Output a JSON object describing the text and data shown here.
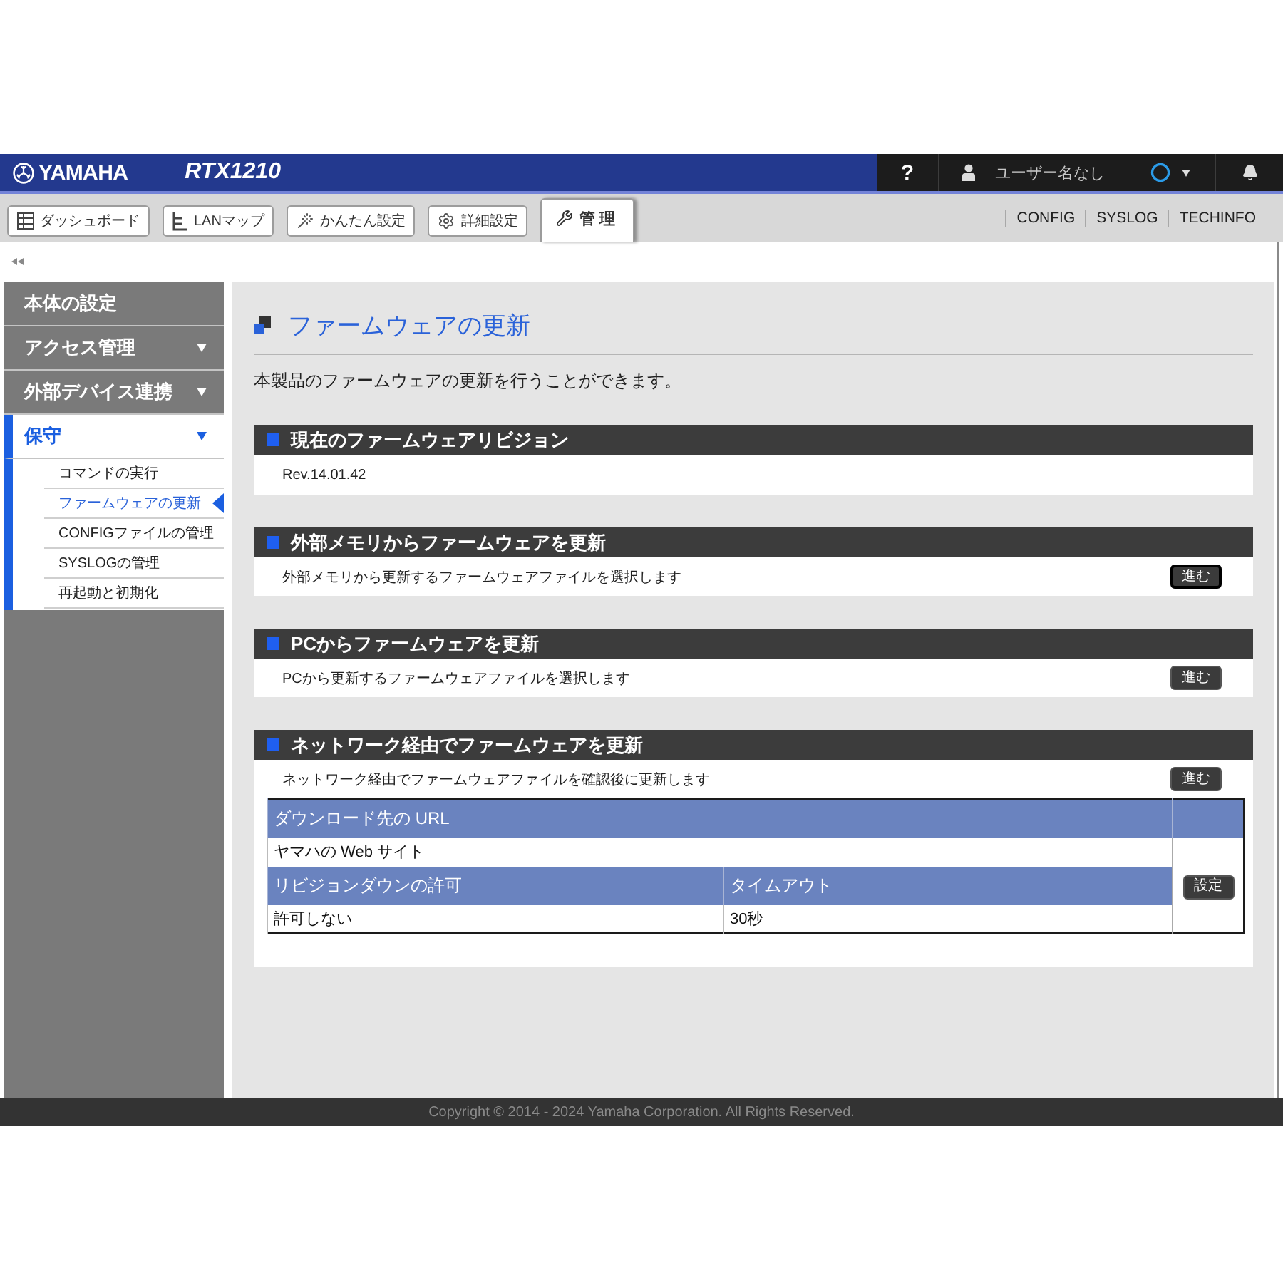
{
  "header": {
    "brand": "YAMAHA",
    "model": "RTX1210",
    "help": "?",
    "user_name": "ユーザー名なし"
  },
  "tabs": [
    {
      "label": "ダッシュボード",
      "selected": false
    },
    {
      "label": "LANマップ",
      "selected": false
    },
    {
      "label": "かんたん設定",
      "selected": false
    },
    {
      "label": "詳細設定",
      "selected": false
    },
    {
      "label": "管 理",
      "selected": true
    }
  ],
  "quick_links": [
    "CONFIG",
    "SYSLOG",
    "TECHINFO"
  ],
  "sidebar": {
    "items": [
      {
        "label": "本体の設定",
        "kind": "link",
        "selected": false
      },
      {
        "label": "アクセス管理",
        "kind": "group",
        "expanded": false
      },
      {
        "label": "外部デバイス連携",
        "kind": "group",
        "expanded": false
      },
      {
        "label": "保守",
        "kind": "group",
        "expanded": true,
        "children": [
          {
            "label": "コマンドの実行",
            "selected": false
          },
          {
            "label": "ファームウェアの更新",
            "selected": true
          },
          {
            "label": "CONFIGファイルの管理",
            "selected": false
          },
          {
            "label": "SYSLOGの管理",
            "selected": false
          },
          {
            "label": "再起動と初期化",
            "selected": false
          }
        ]
      }
    ]
  },
  "page": {
    "title": "ファームウェアの更新",
    "description": "本製品のファームウェアの更新を行うことができます。"
  },
  "sections": [
    {
      "title": "現在のファームウェアリビジョン",
      "text": "Rev.14.01.42"
    },
    {
      "title": "外部メモリからファームウェアを更新",
      "text": "外部メモリから更新するファームウェアファイルを選択します",
      "button": {
        "label": "進む",
        "focused": true
      }
    },
    {
      "title": "PCからファームウェアを更新",
      "text": "PCから更新するファームウェアファイルを選択します",
      "button": {
        "label": "進む",
        "focused": false
      }
    },
    {
      "title": "ネットワーク経由でファームウェアを更新",
      "text": "ネットワーク経由でファームウェアファイルを確認後に更新します",
      "button": {
        "label": "進む",
        "focused": false
      },
      "table": {
        "rows": [
          {
            "kind": "header",
            "cells": [
              {
                "text": "ダウンロード先の URL",
                "colspan": 2
              }
            ]
          },
          {
            "kind": "value",
            "cells": [
              {
                "text": "ヤマハの Web サイト",
                "colspan": 2
              }
            ]
          },
          {
            "kind": "header",
            "cells": [
              {
                "text": "リビジョンダウンの許可"
              },
              {
                "text": "タイムアウト"
              }
            ]
          },
          {
            "kind": "value",
            "cells": [
              {
                "text": "許可しない"
              },
              {
                "text": "30秒"
              }
            ]
          }
        ],
        "button": "設定"
      }
    }
  ],
  "footer": {
    "copyright": "Copyright © 2014 - 2024 Yamaha Corporation. All Rights Reserved."
  }
}
